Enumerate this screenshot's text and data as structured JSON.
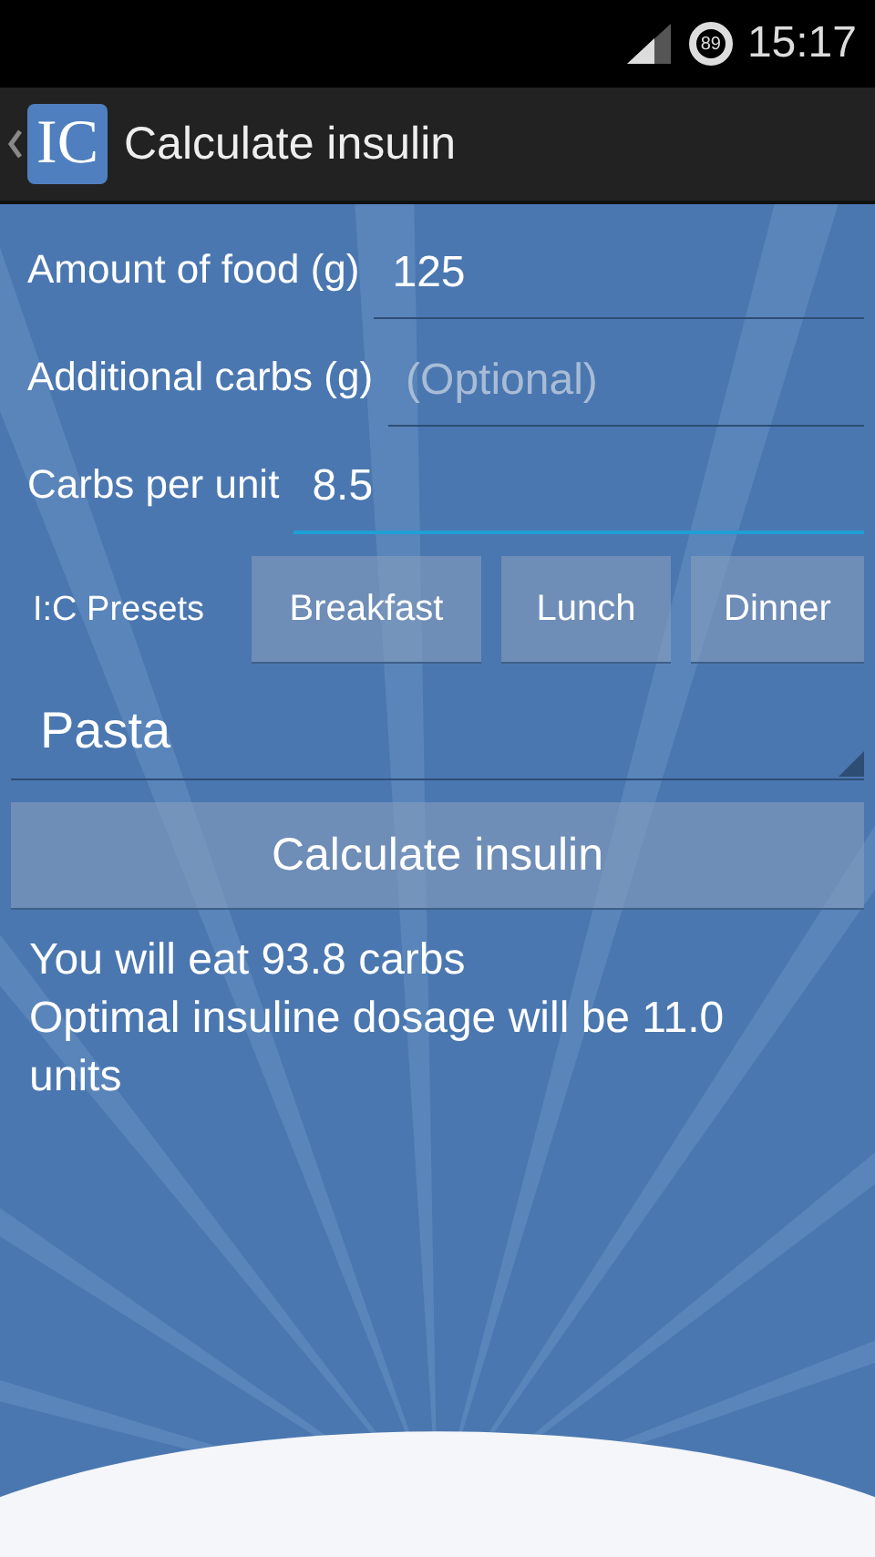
{
  "status_bar": {
    "battery": "89",
    "time": "15:17"
  },
  "action_bar": {
    "logo": "IC",
    "title": "Calculate insulin"
  },
  "fields": [
    {
      "label": "Amount of food (g)",
      "value": "125",
      "focused": false
    },
    {
      "label": "Additional carbs (g)",
      "placeholder": "(Optional)",
      "focused": false
    },
    {
      "label": "Carbs per unit",
      "value": "8.5",
      "focused": true
    }
  ],
  "presets": {
    "label": "I:C Presets",
    "buttons": [
      "Breakfast",
      "Lunch",
      "Dinner"
    ]
  },
  "food_spinner": {
    "value": "Pasta"
  },
  "calculate_button": "Calculate insulin",
  "results": [
    "You will eat 93.8 carbs",
    "Optimal insuline dosage will be 11.0 units"
  ]
}
